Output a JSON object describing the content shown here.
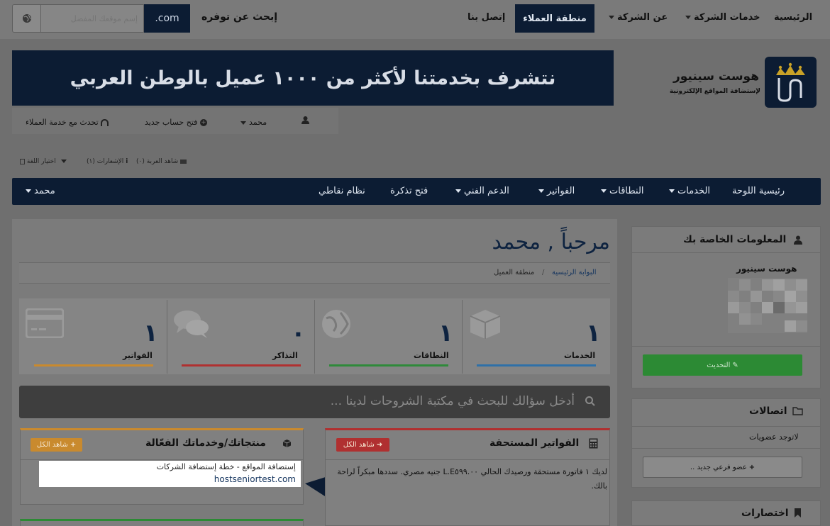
{
  "topnav": {
    "home": "الرئيسية",
    "services": "خدمات الشركة",
    "about": "عن الشركة",
    "client_area": "منطقة العملاء",
    "contact": "إتصل بنا"
  },
  "domain_search": {
    "label": "إبحث عن توفره",
    "tld": ".com",
    "placeholder": "إسم موقعك المفضل"
  },
  "brand": {
    "name": "هوست سينيور",
    "tagline": "لإستضافة المواقع الإلكترونية",
    "banner": "نتشرف بخدمتنا لأكثر من ١٠٠٠ عميل بالوطن العربي"
  },
  "account_bar": {
    "user": "محمد",
    "new_account": "فتح حساب جديد",
    "support": "تحدث مع خدمة العملاء"
  },
  "utility": {
    "cart": "شاهد العربة (٠)",
    "notifications": "الإشعارات (١)",
    "language": "اختيار اللغة"
  },
  "mainnav": {
    "dashboard": "رئيسية اللوحة",
    "services": "الخدمات",
    "domains": "النطاقات",
    "invoices": "الفواتير",
    "support": "الدعم الفني",
    "ticket": "فتح تذكرة",
    "points": "نظام نقاطي",
    "user": "محمد"
  },
  "welcome": "مرحباً , محمد",
  "breadcrumb": {
    "home": "البوابة الرئيسية",
    "current": "منطقة العميل"
  },
  "stats": {
    "services": {
      "value": "١",
      "label": "الخدمات"
    },
    "domains": {
      "value": "١",
      "label": "النطاقات"
    },
    "tickets": {
      "value": "٠",
      "label": "التذاكر"
    },
    "invoices": {
      "value": "١",
      "label": "الفواتير"
    }
  },
  "kb_placeholder": "أدخل سؤالك للبحث في مكتبة الشروحات لدينا ...",
  "products_card": {
    "title": "منتجاتك/وخدماتك الفعّالة",
    "see_all": "شاهد الكل",
    "item_line1": "إستضافة المواقع - خطة إستضافة الشركات",
    "item_line2": "hostseniortest.com"
  },
  "invoices_card": {
    "title": "الفواتير المستحقة",
    "see_all": "شاهد الكل",
    "text": "لديك ١ فاتورة مستحقة ورصيدك الحالي L.E٥٩٩.٠٠ جنيه مصري. سددها مبكراً لراحة بالك."
  },
  "sidebar": {
    "info_title": "المعلومات الخاصة بك",
    "company": "هوست سينيور",
    "update_button": "التحديث",
    "contacts_title": "اتصالات",
    "no_members": "لاتوجد عضويات",
    "new_member_button": "عضو فرعي جديد ..",
    "shortcuts_title": "اختصارات"
  },
  "colors": {
    "navy": "#0c1c33",
    "green": "#2c8a34",
    "red": "#b03030",
    "orange": "#c98a2e"
  }
}
